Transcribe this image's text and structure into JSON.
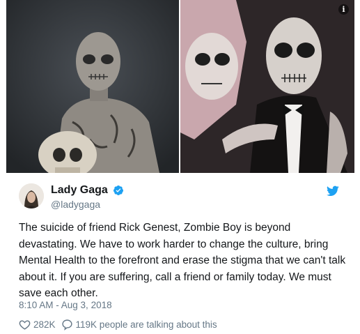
{
  "tweet": {
    "display_name": "Lady Gaga",
    "handle": "@ladygaga",
    "text": "The suicide of friend Rick Genest, Zombie Boy is beyond devastating. We have to work harder to change the culture, bring Mental Health to the forefront and erase the stigma that we can't talk about it. If you are suffering, call a friend or family today. We must save each other.",
    "timestamp": "8:10 AM - Aug 3, 2018",
    "likes": "282K",
    "replies_text": "119K people are talking about this"
  },
  "media": {
    "info_label": "i"
  },
  "icons": {
    "info": "info-icon",
    "verified": "verified-badge-icon",
    "brand": "twitter-bird-icon",
    "like": "heart-icon",
    "reply": "speech-bubble-icon"
  },
  "colors": {
    "name": "#14171a",
    "secondary": "#657786",
    "twitter_blue": "#1da1f2"
  }
}
